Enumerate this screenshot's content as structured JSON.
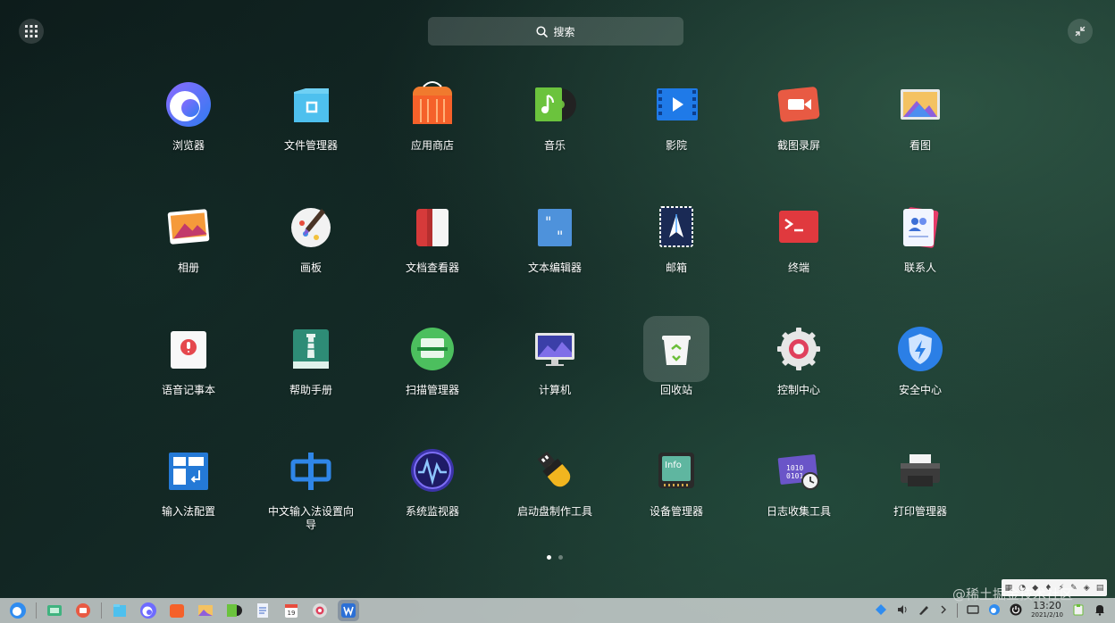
{
  "search": {
    "label": "搜索"
  },
  "apps": [
    {
      "label": "浏览器",
      "icon": "browser-icon"
    },
    {
      "label": "文件管理器",
      "icon": "file-manager-icon"
    },
    {
      "label": "应用商店",
      "icon": "app-store-icon"
    },
    {
      "label": "音乐",
      "icon": "music-icon"
    },
    {
      "label": "影院",
      "icon": "movie-icon"
    },
    {
      "label": "截图录屏",
      "icon": "screen-capture-icon"
    },
    {
      "label": "看图",
      "icon": "image-viewer-icon"
    },
    {
      "label": "相册",
      "icon": "album-icon"
    },
    {
      "label": "画板",
      "icon": "draw-icon"
    },
    {
      "label": "文档查看器",
      "icon": "document-viewer-icon"
    },
    {
      "label": "文本编辑器",
      "icon": "text-editor-icon"
    },
    {
      "label": "邮箱",
      "icon": "mail-icon"
    },
    {
      "label": "终端",
      "icon": "terminal-icon"
    },
    {
      "label": "联系人",
      "icon": "contacts-icon"
    },
    {
      "label": "语音记事本",
      "icon": "voice-note-icon"
    },
    {
      "label": "帮助手册",
      "icon": "manual-icon"
    },
    {
      "label": "扫描管理器",
      "icon": "scanner-icon"
    },
    {
      "label": "计算机",
      "icon": "computer-icon"
    },
    {
      "label": "回收站",
      "icon": "trash-icon"
    },
    {
      "label": "控制中心",
      "icon": "control-center-icon"
    },
    {
      "label": "安全中心",
      "icon": "security-center-icon"
    },
    {
      "label": "输入法配置",
      "icon": "input-method-config-icon"
    },
    {
      "label": "中文输入法设置向导",
      "icon": "chinese-input-icon"
    },
    {
      "label": "系统监视器",
      "icon": "system-monitor-icon"
    },
    {
      "label": "启动盘制作工具",
      "icon": "boot-maker-icon"
    },
    {
      "label": "设备管理器",
      "icon": "device-manager-icon"
    },
    {
      "label": "日志收集工具",
      "icon": "log-collector-icon"
    },
    {
      "label": "打印管理器",
      "icon": "print-manager-icon"
    }
  ],
  "selected_app": "回收站",
  "page_indicator": {
    "pages": 2,
    "current": 1
  },
  "taskbar": {
    "apps": [
      "launcher-icon",
      "multitask-view-icon",
      "screen-record-icon",
      "file-manager-icon",
      "browser-icon",
      "app-store-icon",
      "image-viewer-icon",
      "music-icon",
      "document-icon",
      "calendar-icon",
      "control-center-icon",
      "wps-icon"
    ],
    "calendar_day": "19",
    "clock_time": "13:20",
    "clock_date": "2021/2/10"
  },
  "watermark": "@稀土掘金技术社区",
  "colors": {
    "accent": "#2f8cf0",
    "background": "#142a26"
  }
}
